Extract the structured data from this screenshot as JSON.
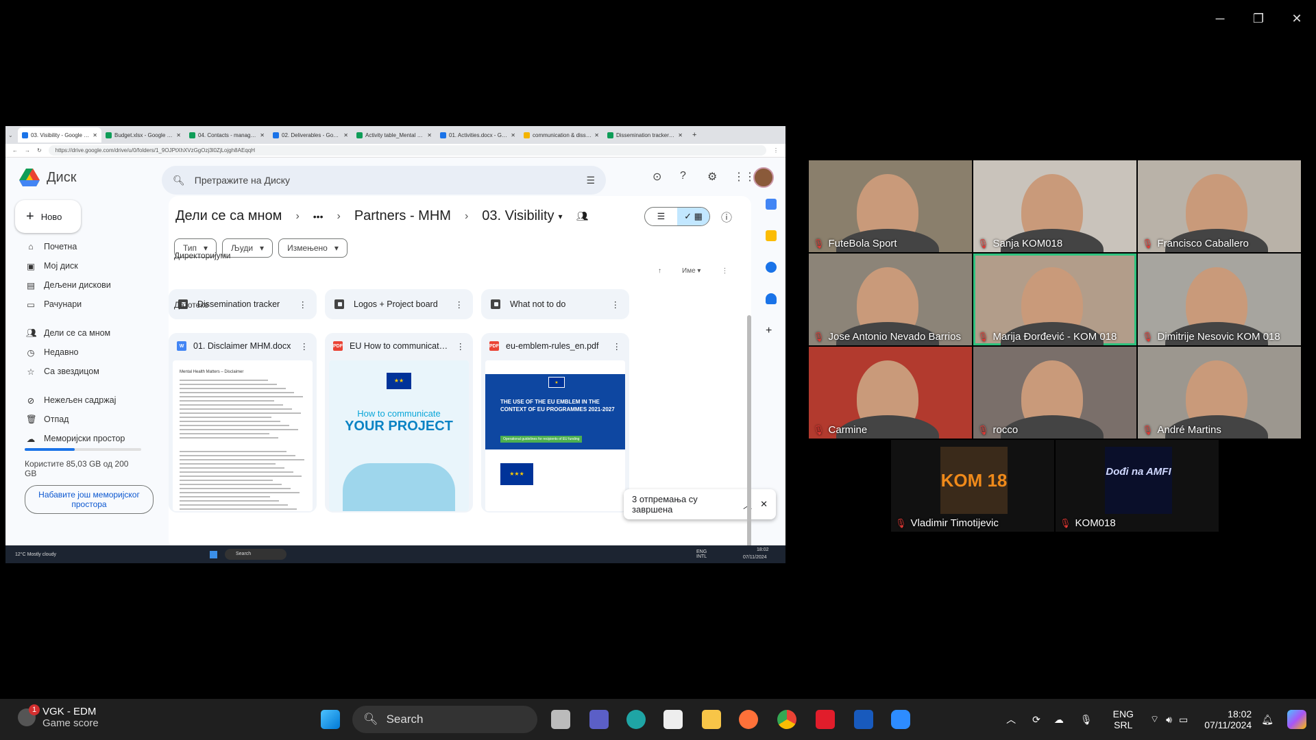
{
  "window": {
    "minimize": "─",
    "restore": "❐",
    "close": "✕"
  },
  "browser": {
    "tabs": [
      {
        "title": "03. Visibility - Google Дис",
        "color": "#1a73e8",
        "active": true
      },
      {
        "title": "Budget.xlsx - Google табе",
        "color": "#0f9d58"
      },
      {
        "title": "04. Contacts - manageme",
        "color": "#0f9d58"
      },
      {
        "title": "02. Deliverables - Google",
        "color": "#1a73e8"
      },
      {
        "title": "Activity table_Mental hea",
        "color": "#0f9d58"
      },
      {
        "title": "01. Activities.docx - Goog",
        "color": "#1a73e8"
      },
      {
        "title": "communication & dissem",
        "color": "#f4b400"
      },
      {
        "title": "Dissemination tracker - N",
        "color": "#0f9d58"
      }
    ],
    "new_tab": "+",
    "url": "https://drive.google.com/drive/u/0/folders/1_9OJPtXhXVzGgOzj3l0ZjLojgh8AEqqH"
  },
  "drive": {
    "app_name": "Диск",
    "search_placeholder": "Претражите на Диску",
    "new_label": "Ново",
    "nav": [
      {
        "icon": "home-icon",
        "label": "Почетна"
      },
      {
        "icon": "my-drive-icon",
        "label": "Мој диск"
      },
      {
        "icon": "shared-drives-icon",
        "label": "Дељени дискови"
      },
      {
        "icon": "computers-icon",
        "label": "Рачунари"
      },
      {
        "icon": "shared-with-me-icon",
        "label": "Дели се са мном"
      },
      {
        "icon": "recent-icon",
        "label": "Недавно"
      },
      {
        "icon": "star-icon",
        "label": "Са звездицом"
      },
      {
        "icon": "spam-icon",
        "label": "Нежељен садржај"
      },
      {
        "icon": "trash-icon",
        "label": "Отпад"
      },
      {
        "icon": "cloud-icon",
        "label": "Меморијски простор"
      }
    ],
    "storage": {
      "text": "Користите 85,03 GB од 200 GB",
      "used_fraction": 0.43,
      "button": "Набавите још меморијског простора"
    },
    "breadcrumb": [
      "Дели се са мном",
      "•••",
      "Partners - МНМ",
      "03. Visibility"
    ],
    "filters": [
      "Тип",
      "Људи",
      "Измењено"
    ],
    "sort_label": "Име",
    "folders_label": "Директоријуми",
    "files_label": "Датотеке",
    "folders": [
      "Dissemination tracker",
      "Logos + Project board",
      "What not to do"
    ],
    "files": [
      {
        "name": "01. Disclaimer MHM.docx",
        "type": "W",
        "color": "#4285f4",
        "thumb_title": "Mental Health Matters – Disclaimer"
      },
      {
        "name": "EU How to communicate yo...",
        "type": "PDF",
        "color": "#ea4335",
        "thumb_l1": "How to communicate",
        "thumb_l2": "YOUR PROJECT"
      },
      {
        "name": "eu-emblem-rules_en.pdf",
        "type": "PDF",
        "color": "#ea4335",
        "thumb_l1": "THE USE OF THE EU EMBLEM IN THE CONTEXT OF EU PROGRAMMES 2021-2027",
        "thumb_l2": "Operational guidelines for recipients of EU funding"
      }
    ],
    "toast": "3 отпремања су завршена"
  },
  "inner_taskbar": {
    "weather": "12°C Mostly cloudy",
    "search": "Search",
    "lang": "ENG INTL",
    "time": "18:02",
    "date": "07/11/2024"
  },
  "participants": [
    {
      "name": "FuteBola Sport",
      "bg": "#8a7f6c"
    },
    {
      "name": "Sanja KOM018",
      "bg": "#c9c3bb"
    },
    {
      "name": "Francisco Caballero",
      "bg": "#b9b2a8"
    },
    {
      "name": "Jose Antonio Nevado Barrios",
      "bg": "#8c8478"
    },
    {
      "name": "Marija Đorđević - KOM 018",
      "bg": "#b29d8a",
      "speaking": true
    },
    {
      "name": "Dimitrije Nesovic KOM 018",
      "bg": "#a7a59f"
    },
    {
      "name": "Carmine",
      "bg": "#b23a2e"
    },
    {
      "name": "rocco",
      "bg": "#7a6f6a"
    },
    {
      "name": "André Martins",
      "bg": "#9c978f"
    },
    {
      "name": "Vladimir Timotijevic",
      "bg": "#111"
    },
    {
      "name": "KOM018",
      "bg": "#111"
    }
  ],
  "avatars": {
    "kom": "KOM 18",
    "dodji": "Dođi na AMFI"
  },
  "taskbar": {
    "notification_count": "1",
    "weather_title": "VGK - EDM",
    "weather_sub": "Game score",
    "search": "Search",
    "lang1": "ENG",
    "lang2": "SRL",
    "time": "18:02",
    "date": "07/11/2024"
  }
}
